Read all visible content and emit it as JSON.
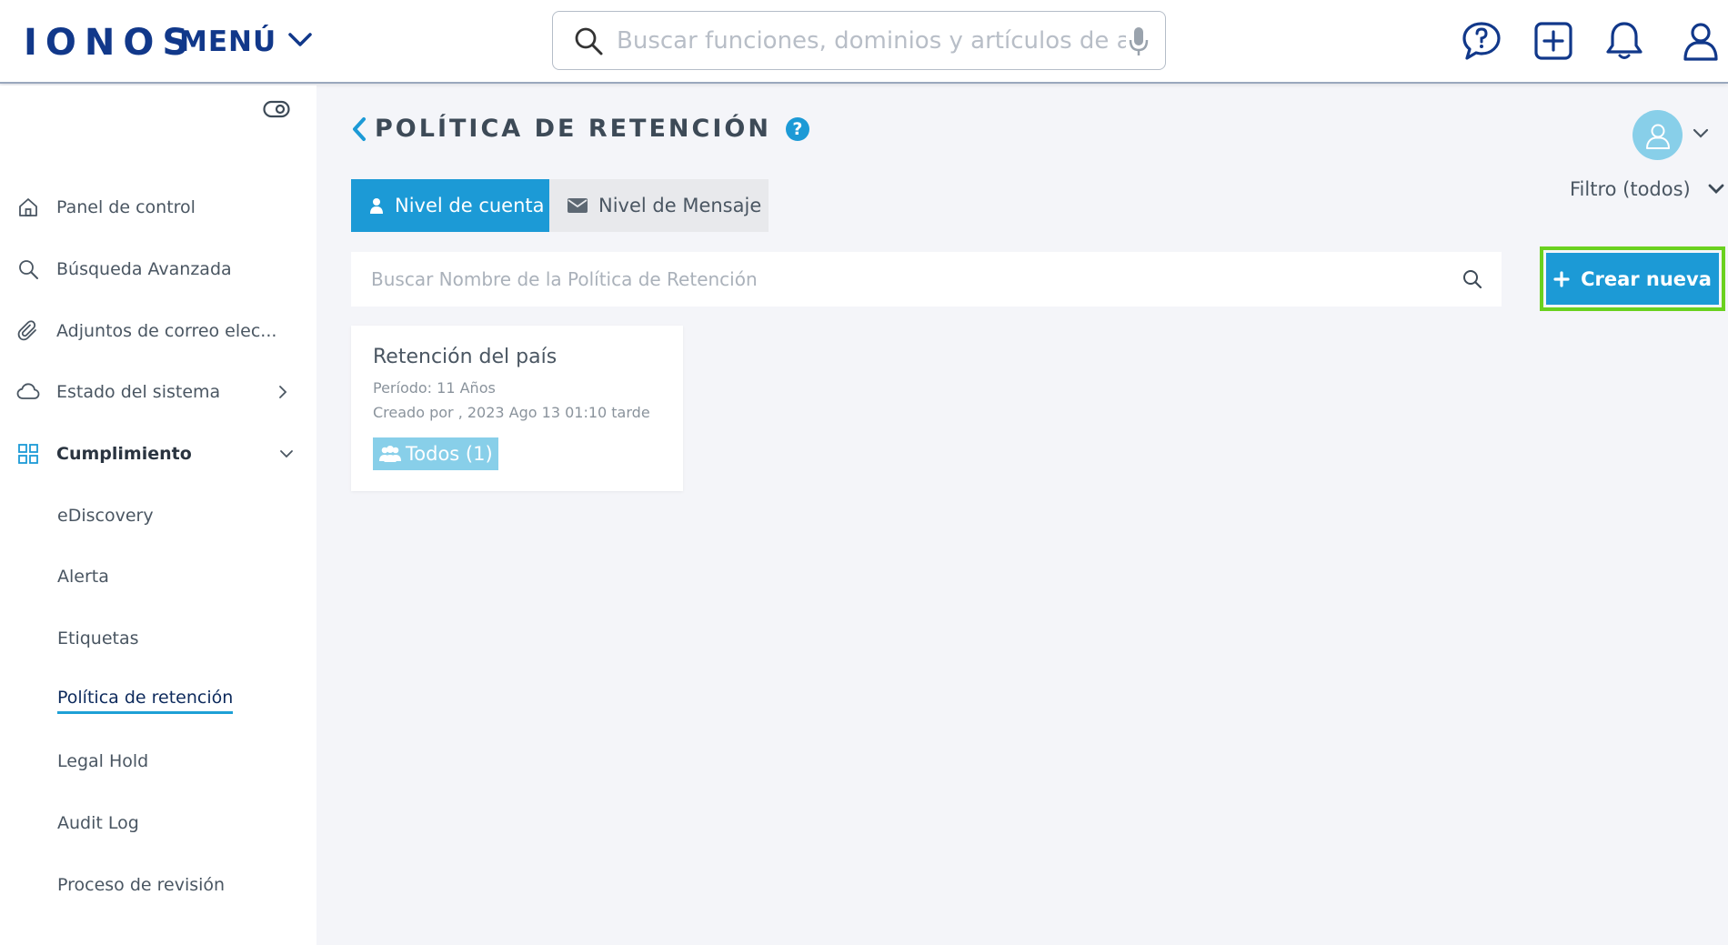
{
  "header": {
    "logo": "IONOS",
    "menu_label": "MENÚ",
    "search_placeholder": "Buscar funciones, dominios y artículos de ayuda"
  },
  "sidebar": {
    "items": [
      {
        "label": "Panel de control",
        "icon": "home-icon"
      },
      {
        "label": "Búsqueda Avanzada",
        "icon": "search-icon"
      },
      {
        "label": "Adjuntos de correo elec...",
        "icon": "paperclip-icon"
      },
      {
        "label": "Estado del sistema",
        "icon": "cloud-icon"
      },
      {
        "label": "Cumplimiento",
        "icon": "grid-icon"
      }
    ],
    "subitems": [
      "eDiscovery",
      "Alerta",
      "Etiquetas",
      "Política de retención",
      "Legal Hold",
      "Audit Log",
      "Proceso de revisión"
    ],
    "active_subitem": "Política de retención"
  },
  "main": {
    "title": "POLÍTICA DE RETENCIÓN",
    "help_symbol": "?",
    "filter_label": "Filtro (todos)",
    "tabs": [
      {
        "label": "Nivel de cuenta",
        "icon": "user-icon",
        "active": true
      },
      {
        "label": "Nivel de Mensaje",
        "icon": "envelope-icon",
        "active": false
      }
    ],
    "search_placeholder": "Buscar Nombre de la Política de Retención",
    "create_label": "Crear nueva",
    "policies": [
      {
        "title": "Retención del país",
        "period": "Período: 11 Años",
        "created": "Creado por , 2023 Ago 13 01:10 tarde",
        "badge": "Todos (1)"
      }
    ]
  },
  "colors": {
    "brand_navy": "#11388a",
    "accent_blue": "#1c9ad6",
    "light_blue": "#88cfe9",
    "highlight_green": "#6ad11f"
  }
}
